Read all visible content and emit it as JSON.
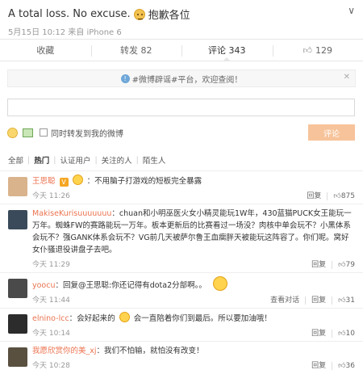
{
  "post": {
    "title": "A total loss. No excuse.",
    "title_suffix": "抱歉各位",
    "meta": "5月15日 10:12 来自 iPhone 6"
  },
  "actions": {
    "collect": "收藏",
    "repost": "转发 82",
    "comment": "评论 343",
    "like": "129"
  },
  "notice": {
    "text": "#微博辟谣#平台，欢迎查阅！"
  },
  "composer": {
    "input_value": "",
    "repost_label": "同时转发到我的微博",
    "submit_label": "评论"
  },
  "filters": [
    "全部",
    "热门",
    "认证用户",
    "关注的人",
    "陌生人"
  ],
  "comments": [
    {
      "user": "王思聪",
      "text": "：不用脑子打游戏的短板完全暴露",
      "time": "今天 11:26",
      "reply": "回复",
      "likes": "875",
      "avatar_color": "#d9b38c"
    },
    {
      "user": "MakiseKurisuuuuuuu",
      "text": "：chuan和小明巫医火女小精灵能玩1W年，430蓝猫PUCK女王能玩一万年。蜘蛛FW的赛路能玩一万年。板本更新后的比赛看过一场没？肉核中单会玩不？小黑体系会玩不？强GANK体系会玩不？VG前几天被萨尔鲁王血瘸胖天被能玩这阵容了。你们呢。窝好女仆骚退役讲盘子去吧。",
      "time": "今天 11:29",
      "reply": "回复",
      "likes": "79",
      "avatar_color": "#3a4a5a"
    },
    {
      "user": "yoocu",
      "text": "：回复@王思聪:你还记得有dota2分部啊。。",
      "time": "今天 11:44",
      "view_convo": "查看对话",
      "reply": "回复",
      "likes": "31",
      "avatar_color": "#4a4a4a"
    },
    {
      "user": "elnino-lcc",
      "text_a": "：会好起来的",
      "text_b": "会一直陪着你们到最后。所以要加油哦！",
      "time": "今天 10:14",
      "reply": "回复",
      "likes": "10",
      "avatar_color": "#2c2c2c"
    },
    {
      "user": "我愿欣赏你的美_xj",
      "text": "：我们不怕输，就怕没有改变！",
      "time": "今天 10:28",
      "reply": "回复",
      "likes": "36",
      "avatar_color": "#5a5040"
    }
  ]
}
